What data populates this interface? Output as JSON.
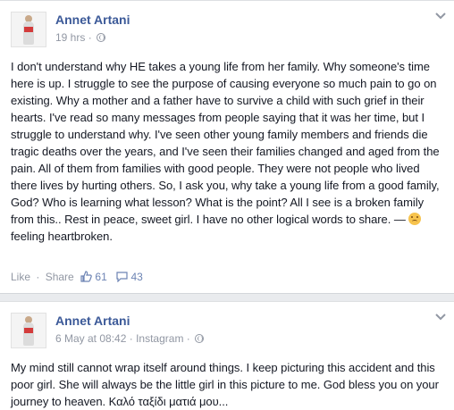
{
  "posts": [
    {
      "author": "Annet Artani",
      "timestamp": "19 hrs",
      "meta_sep": "·",
      "privacy_icon": "globe-icon",
      "body": "I don't understand why HE takes a young life from her family. Why someone's time here is up. I struggle to see the purpose of causing everyone so much pain to go on existing. Why a mother and a father have to survive a child with such grief in their hearts. I've read so many messages from people saying that it was her time, but I struggle to understand why. I've seen other young family members and friends die tragic deaths over the years, and I've seen their families changed and aged from the pain. All of them from families with good people. They were not people who lived there lives by hurting others. So, I ask you, why take a young life from a good family, God? Who is learning what lesson? What is the point? All I see is a broken family from this.. Rest in peace, sweet girl. I have no other logical words to share. — ",
      "feeling": "feeling heartbroken.",
      "actions": {
        "like": "Like",
        "sep": "·",
        "share": "Share",
        "likes_count": "61",
        "comments_count": "43"
      }
    },
    {
      "author": "Annet Artani",
      "timestamp": "6 May at 08:42",
      "meta_sep": "·",
      "source": "Instagram",
      "privacy_icon": "globe-icon",
      "body": "My mind still cannot wrap itself around things. I keep picturing this accident and this poor girl. She will always be the little girl in this picture to me. God bless you on your journey to heaven. Καλό ταξίδι ματιά μου..."
    }
  ],
  "colors": {
    "name": "#3b5998",
    "meta": "#9197a3",
    "counts": "#6d84b4",
    "text": "#141823"
  }
}
